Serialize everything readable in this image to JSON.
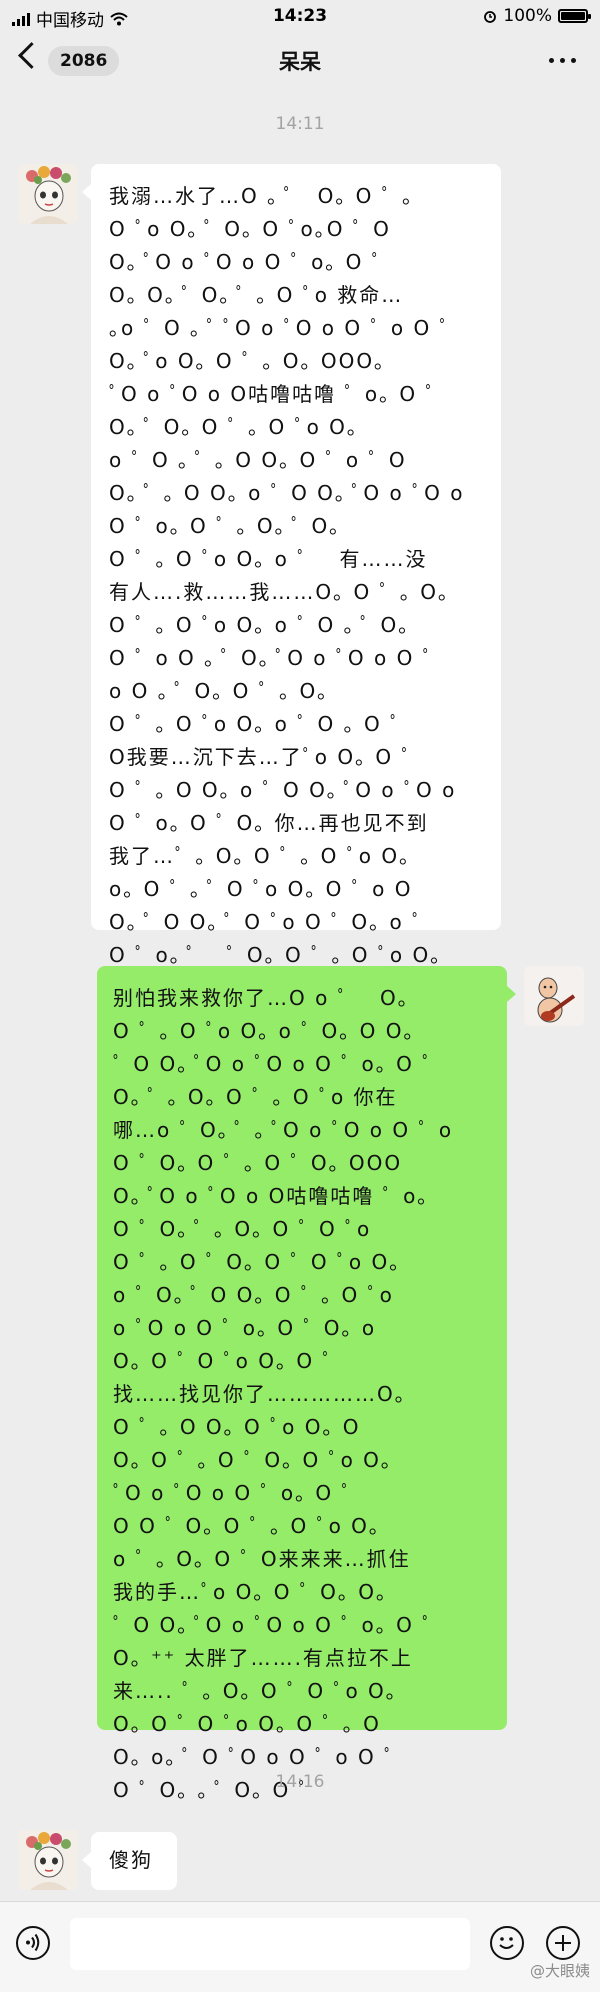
{
  "status_bar": {
    "carrier": "中国移动",
    "time": "14:23",
    "battery": "100%"
  },
  "nav": {
    "unread_count": "2086",
    "title": "呆呆"
  },
  "messages": {
    "ts1": "14:11",
    "m1_text": "我溺…水了…O ｡ ﾟ　O｡ O ﾟ ｡ \nO ﾟo O｡ ﾟ O｡ O ﾟo｡O ﾟ O\nO｡ ﾟO o ﾟO o O ﾟ o｡ O ﾟ\nO｡ O｡ ﾟ O｡ ﾟ ｡ O ﾟo 救命…\n｡o ﾟ O ｡ ﾟ ﾟO o ﾟO o O ﾟ o O ﾟ\nO｡ ﾟo O｡ O ﾟ ｡ O｡ OOO｡\nﾟO o ﾟO o O咕噜咕噜 ﾟ o｡ O ﾟ\nO｡ ﾟ O｡ O ﾟ ｡ O ﾟo O｡\no ﾟ O ｡ ﾟ ｡ O O｡ O ﾟ o ﾟ O\nO｡ ﾟ ｡ O O｡ o ﾟ O O｡ ﾟO o ﾟO o\nO ﾟ o｡ O ﾟ ｡ O｡ ﾟ O｡\nO ﾟ ｡ O ﾟo O｡ o ﾟ 　有……没\n有人….救……我……O｡ O ﾟ ｡ O｡\nO ﾟ ｡ O ﾟo O｡ o ﾟ O ｡ ﾟ O｡\nO ﾟ o O ｡ ﾟ O｡ ﾟO o ﾟO o O ﾟ\no O ｡ ﾟ O｡ O ﾟ ｡ O｡\nO ﾟ ｡ O ﾟo O｡ o ﾟ O ｡ O ﾟ\nO我要…沉下去…了ﾟo O｡ O ﾟ\nO ﾟ ｡ O O｡ o ﾟ O O｡ ﾟO o ﾟO o\nO ﾟ o｡ O ﾟ O｡ 你…再也见不到\n我了…ﾟ ｡ O｡ O ﾟ ｡ O ﾟo O｡\no｡ O ﾟ ｡ ﾟ O ﾟo O｡ O ﾟ o O\nO｡ ﾟ O O｡ ﾟ O ﾟo O ﾟ O｡ o ﾟ\nO ﾟ o｡ ﾟ 　ﾟ O｡ O ﾟ ｡ O ﾟo O｡\nO｡ o",
    "m2_text": "别怕我来救你了…O o ﾟ 　O｡\nO ﾟ ｡ O ﾟo O｡ o ﾟ O｡ O O｡\nﾟ O O｡ ﾟO o ﾟO o O ﾟ o｡ O ﾟ\nO｡ ﾟ ｡ O｡ O ﾟ ｡ O ﾟo 你在\n哪…o ﾟ O｡ ﾟ ｡ ﾟO o ﾟO o O ﾟ o\nO ﾟ O｡ O ﾟ ｡ O ﾟ O｡ OOO\nO｡ ﾟO o ﾟO o O咕噜咕噜 ﾟ o｡\nO ﾟ O｡ ﾟ ｡ O｡ O ﾟ O ﾟo\nO ﾟ ｡ O ﾟ O｡ O ﾟ O ﾟo O｡\no ﾟ O｡ ﾟ O O｡ O ﾟ ｡ O ﾟo\no ﾟO o O ﾟ o｡ O ﾟ O｡ o\nO｡ O ﾟ O ﾟo O｡ O ﾟ\n找……找见你了……………O｡\nO ﾟ ｡ O O｡ O ﾟo O｡ O\nO｡ O ﾟ ｡ O ﾟ O｡ O ﾟo O｡\nﾟO o ﾟO o O ﾟ o｡ O ﾟ\nO O ﾟ O｡ O ﾟ ｡ O ﾟo O｡\no ﾟ ｡ O｡ O ﾟ O来来来…抓住\n我的手…ﾟo O｡ O ﾟ O｡ O｡\nﾟ O O｡ ﾟO o ﾟO o O ﾟ o｡ O ﾟ\nO｡ ⁺⁺ 太胖了…….有点拉不上\n来….. ﾟ ｡ O｡ O ﾟ O ﾟo O｡\nO｡ O ﾟ O ﾟo O｡ O ﾟ ｡ O\nO｡ o｡ ﾟ O ﾟO o O ﾟ o O ﾟ\nO ﾟ O｡ ｡ ﾟ O｡ O ﾟ",
    "ts2": "14:16",
    "m3_text": "傻狗"
  },
  "watermark": "@大眼姨"
}
